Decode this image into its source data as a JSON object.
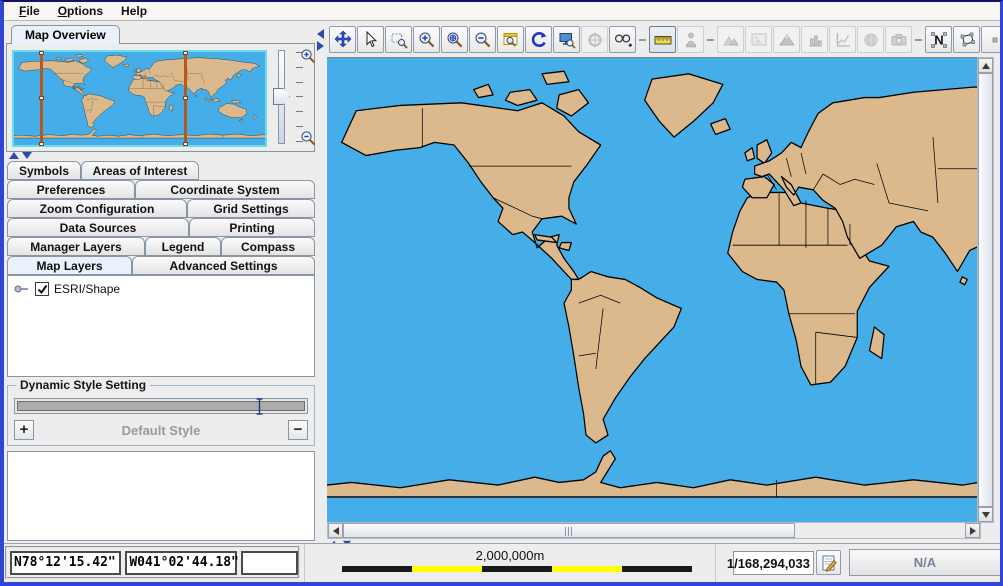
{
  "theme": {
    "ocean-color": "#45AEE8",
    "land-color": "#DBB98D",
    "viewport-line-color": "#B55A1E",
    "window-border": "#2F46D2",
    "selected-tab-bg": "#E9F1FA",
    "scale-yellow": "#FFFF00",
    "na-text": "#76839B",
    "accent-blue": "#2B4FD0"
  },
  "menu": {
    "items": [
      {
        "label": "File"
      },
      {
        "label": "Options"
      },
      {
        "label": "Help"
      }
    ]
  },
  "overview": {
    "tab_label": "Map Overview",
    "icons": [
      "zoom-in-magnifier",
      "zoom-out-magnifier"
    ]
  },
  "sidebar_tabs": {
    "selected": "Map Layers",
    "rows": [
      [
        {
          "label": "Symbols"
        },
        {
          "label": "Areas of Interest"
        }
      ],
      [
        {
          "label": "Preferences"
        },
        {
          "label": "Coordinate System"
        }
      ],
      [
        {
          "label": "Zoom Configuration"
        },
        {
          "label": "Grid Settings"
        }
      ],
      [
        {
          "label": "Data Sources"
        },
        {
          "label": "Printing"
        }
      ],
      [
        {
          "label": "Manager Layers"
        },
        {
          "label": "Legend"
        },
        {
          "label": "Compass"
        }
      ],
      [
        {
          "label": "Map Layers"
        },
        {
          "label": "Advanced Settings"
        }
      ]
    ]
  },
  "map_layers": {
    "tree": [
      {
        "label": "ESRI/Shape",
        "checked": true
      }
    ]
  },
  "style_panel": {
    "title": "Dynamic Style Setting",
    "plus": "+",
    "minus": "−",
    "style_name": "Default Style"
  },
  "toolbar": {
    "buttons": [
      {
        "name": "pan-tool",
        "enabled": true
      },
      {
        "name": "select-tool",
        "enabled": true
      },
      {
        "name": "zoom-box-tool",
        "enabled": true
      },
      {
        "name": "zoom-in-tool",
        "enabled": true
      },
      {
        "name": "zoom-point-tool",
        "enabled": true
      },
      {
        "name": "zoom-out-tool",
        "enabled": true
      },
      {
        "name": "overview-window-tool",
        "enabled": true
      },
      {
        "name": "refresh-tool",
        "enabled": true
      },
      {
        "name": "screen-zoom-tool",
        "enabled": true
      },
      {
        "name": "target-tool",
        "enabled": false
      },
      {
        "name": "glasses-tool",
        "enabled": true
      },
      {
        "name": "ruler-tool",
        "enabled": true
      },
      {
        "name": "statue-tool",
        "enabled": false
      },
      {
        "name": "terrain-tool",
        "enabled": false
      },
      {
        "name": "image-tool",
        "enabled": false
      },
      {
        "name": "mountain-tool",
        "enabled": false
      },
      {
        "name": "bar-chart-tool",
        "enabled": false
      },
      {
        "name": "line-chart-tool",
        "enabled": false
      },
      {
        "name": "globe-tool",
        "enabled": false
      },
      {
        "name": "camera-tool",
        "enabled": false
      },
      {
        "name": "node-edit-tool",
        "enabled": true
      },
      {
        "name": "polygon-edit-tool",
        "enabled": true
      },
      {
        "name": "point-tool",
        "enabled": true
      },
      {
        "name": "polyline-edit-tool",
        "enabled": true
      }
    ]
  },
  "statusbar": {
    "latitude": "N78°12'15.42\"",
    "longitude": "W041°02'44.18\"",
    "third_value": "",
    "scale_label": "2,000,000m",
    "scale_bar_segments": [
      "black",
      "yellow",
      "black",
      "yellow",
      "black"
    ],
    "scale_ratio": "1/168,294,033",
    "edit_icon": "pencil-edit",
    "right_status": "N/A"
  }
}
